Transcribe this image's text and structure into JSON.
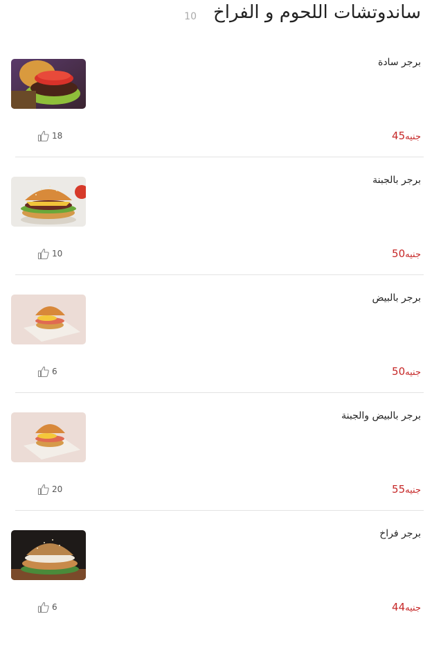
{
  "header": {
    "title": "ساندوتشات اللحوم و الفراخ",
    "count": "10"
  },
  "currency": "جنيه",
  "like_icon": "thumbs-up-icon",
  "items": [
    {
      "name": "برجر سادة",
      "price": "45",
      "likes": "18",
      "image": "plain-burger"
    },
    {
      "name": "برجر بالجبنة",
      "price": "50",
      "likes": "10",
      "image": "cheese-burger"
    },
    {
      "name": "برجر بالبيض",
      "price": "50",
      "likes": "6",
      "image": "egg-burger"
    },
    {
      "name": "برجر بالبيض والجبنة",
      "price": "55",
      "likes": "20",
      "image": "egg-cheese-burger"
    },
    {
      "name": "برجر فراخ",
      "price": "44",
      "likes": "6",
      "image": "chicken-burger"
    }
  ]
}
